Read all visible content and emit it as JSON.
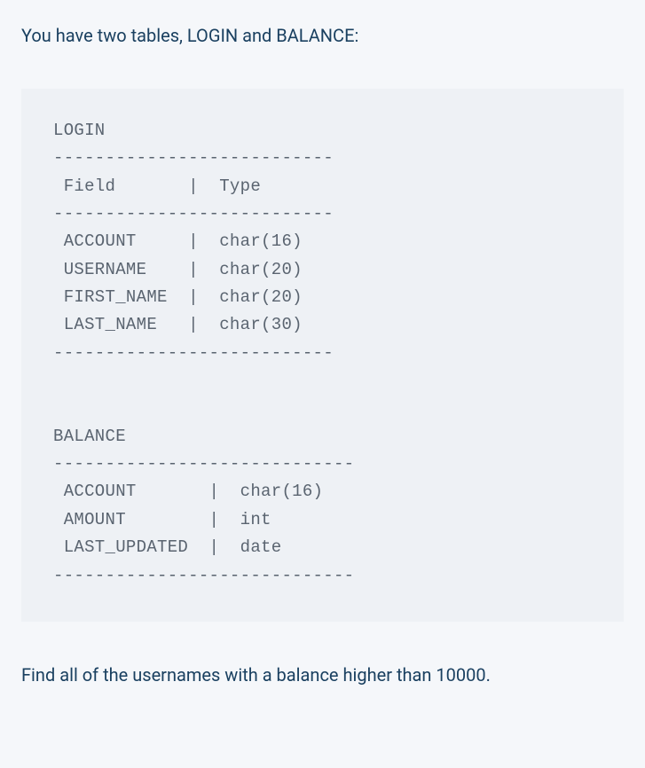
{
  "intro": "You have two tables, LOGIN and BALANCE:",
  "code": "LOGIN\n---------------------------\n Field       |  Type\n---------------------------\n ACCOUNT     |  char(16)\n USERNAME    |  char(20)\n FIRST_NAME  |  char(20)\n LAST_NAME   |  char(30)\n---------------------------\n\n\nBALANCE\n-----------------------------\n ACCOUNT       |  char(16)\n AMOUNT        |  int\n LAST_UPDATED  |  date\n-----------------------------",
  "outro": "Find all of the usernames with a balance higher than 10000."
}
